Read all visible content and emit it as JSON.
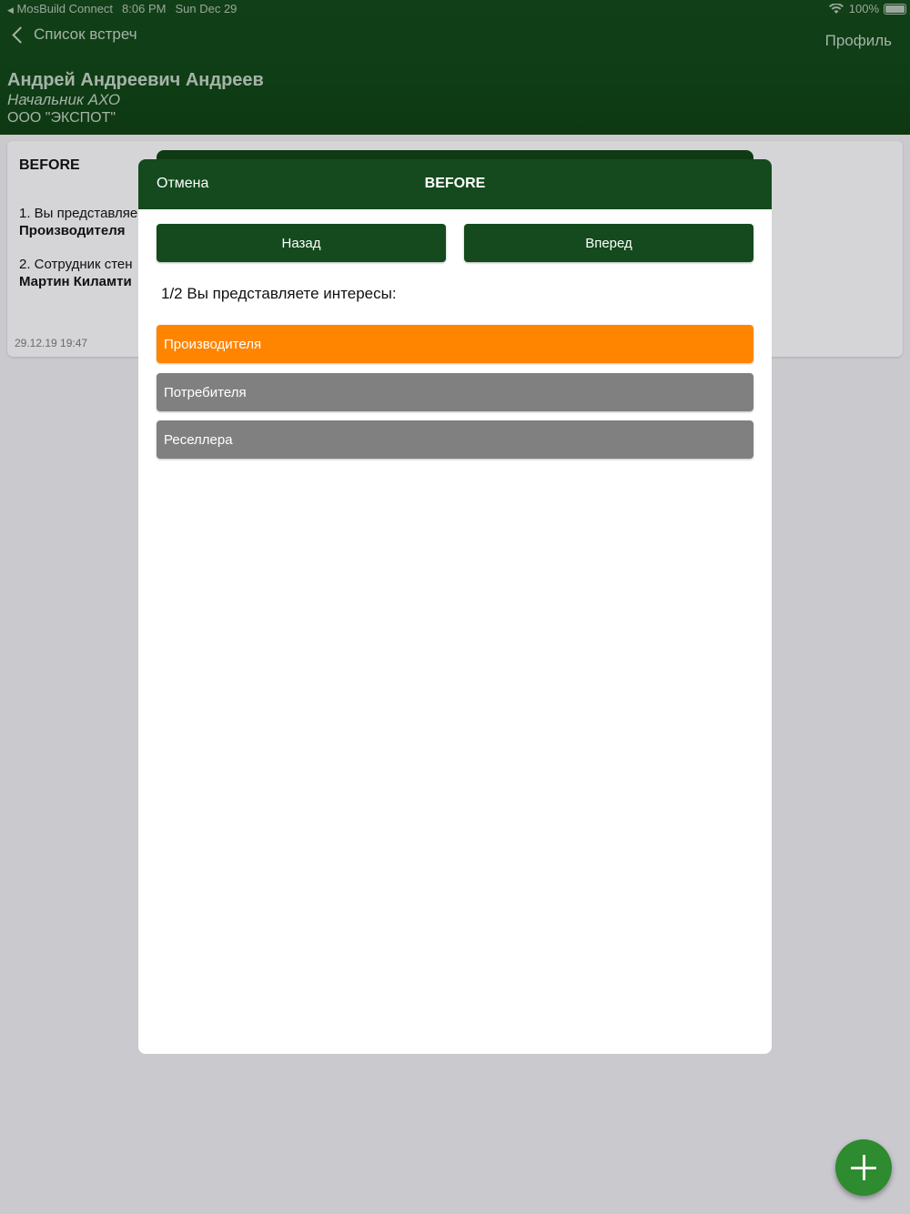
{
  "status_bar": {
    "back_app": "MosBuild Connect",
    "time": "8:06 PM",
    "date": "Sun Dec 29",
    "battery": "100%"
  },
  "nav": {
    "back_label": "Список встреч",
    "profile_label": "Профиль"
  },
  "user": {
    "name": "Андрей Андреевич Андреев",
    "role": "Начальник АХО",
    "company": "ООО \"ЭКСПОТ\""
  },
  "background_card": {
    "title": "BEFORE",
    "q1_text": "1. Вы представляе",
    "q1_answer": "Производителя",
    "q2_text": "2. Сотрудник стен",
    "q2_answer": "Мартин Киламти",
    "timestamp": "29.12.19 19:47"
  },
  "modal": {
    "cancel_label": "Отмена",
    "title": "BEFORE",
    "back_button": "Назад",
    "forward_button": "Вперед",
    "question": "1/2 Вы представляете интересы:",
    "options": [
      {
        "label": "Производителя",
        "color": "#ff8500"
      },
      {
        "label": "Потребителя",
        "color": "#808080"
      },
      {
        "label": "Реселлера",
        "color": "#808080"
      }
    ]
  },
  "colors": {
    "header_green": "#144a1d",
    "selected_option": "#ff8500",
    "unselected_option": "#808080",
    "fab_green": "#2e8b2f"
  },
  "fab": {
    "icon": "plus-icon"
  }
}
